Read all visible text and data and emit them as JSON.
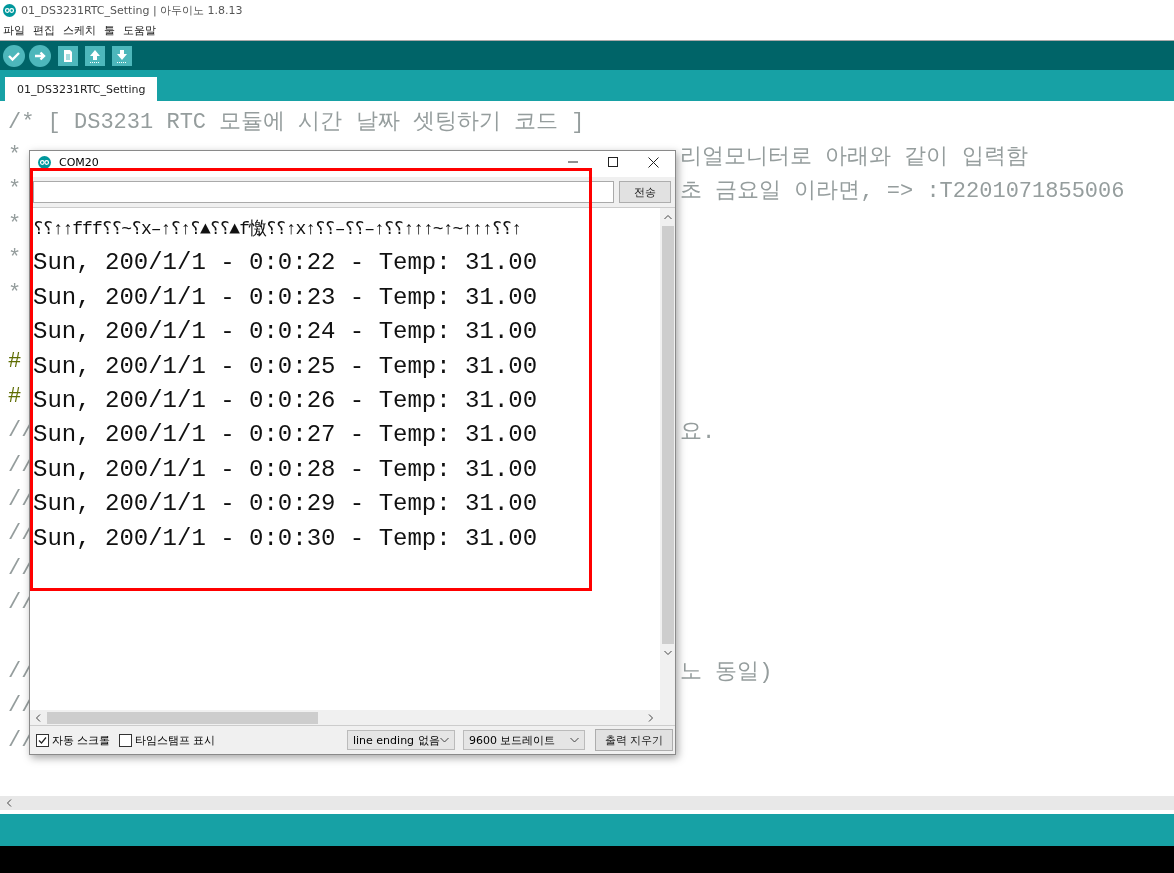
{
  "window": {
    "title": "01_DS3231RTC_Setting | 아두이노 1.8.13"
  },
  "menu": [
    "파일",
    "편집",
    "스케치",
    "툴",
    "도움말"
  ],
  "toolbar": [
    {
      "kind": "verify"
    },
    {
      "kind": "upload"
    },
    {
      "kind": "new"
    },
    {
      "kind": "open"
    },
    {
      "kind": "save"
    }
  ],
  "tabs": [
    {
      "label": "01_DS3231RTC_Setting",
      "selected": true
    }
  ],
  "editor": {
    "lines": [
      {
        "kind": "comment",
        "text": "/* [ DS3231 RTC 모듈에 시간 날짜 셋팅하기 코드 ]"
      },
      {
        "kind": "comment",
        "left": "*",
        "right": "리얼모니터로 아래와 같이 입력함"
      },
      {
        "kind": "comment",
        "left": "*",
        "right": "초 금요일 이라면, => :T2201071855006"
      },
      {
        "kind": "comment",
        "left": "*"
      },
      {
        "kind": "comment",
        "left": "*"
      },
      {
        "kind": "comment",
        "left": "*"
      },
      {
        "kind": "blank"
      },
      {
        "kind": "directive",
        "left": "#"
      },
      {
        "kind": "directive",
        "left": "#"
      },
      {
        "kind": "comment",
        "left": "//",
        "right": "요."
      },
      {
        "kind": "comment",
        "left": "//"
      },
      {
        "kind": "comment",
        "left": "//"
      },
      {
        "kind": "comment",
        "left": "//"
      },
      {
        "kind": "comment",
        "left": "//"
      },
      {
        "kind": "comment",
        "left": "//"
      },
      {
        "kind": "blank"
      },
      {
        "kind": "comment",
        "left": "//",
        "right": "노 동일)"
      },
      {
        "kind": "comment",
        "left": "//"
      },
      {
        "kind": "comment",
        "left": "//"
      }
    ]
  },
  "serial_monitor": {
    "title": "COM20",
    "send_label": "전송",
    "output": [
      "⸮⸮↑↑fff⸮⸮~⸮x–↑⸮↑⸮▲⸮⸮▲f憿⸮⸮↑x↑⸮⸮–⸮⸮–↑⸮⸮↑↑↑~↑~↑↑↑⸮⸮↑",
      "Sun, 200/1/1 - 0:0:22 - Temp: 31.00",
      "Sun, 200/1/1 - 0:0:23 - Temp: 31.00",
      "Sun, 200/1/1 - 0:0:24 - Temp: 31.00",
      "Sun, 200/1/1 - 0:0:25 - Temp: 31.00",
      "Sun, 200/1/1 - 0:0:26 - Temp: 31.00",
      "Sun, 200/1/1 - 0:0:27 - Temp: 31.00",
      "Sun, 200/1/1 - 0:0:28 - Temp: 31.00",
      "Sun, 200/1/1 - 0:0:29 - Temp: 31.00",
      "Sun, 200/1/1 - 0:0:30 - Temp: 31.00"
    ],
    "options": [
      {
        "label": "자동 스크롤",
        "checked": true
      },
      {
        "label": "타임스탬프 표시",
        "checked": false
      }
    ],
    "line_ending": "line ending 없음",
    "baud_rate": "9600 보드레이트",
    "clear_label": "출력 지우기"
  }
}
